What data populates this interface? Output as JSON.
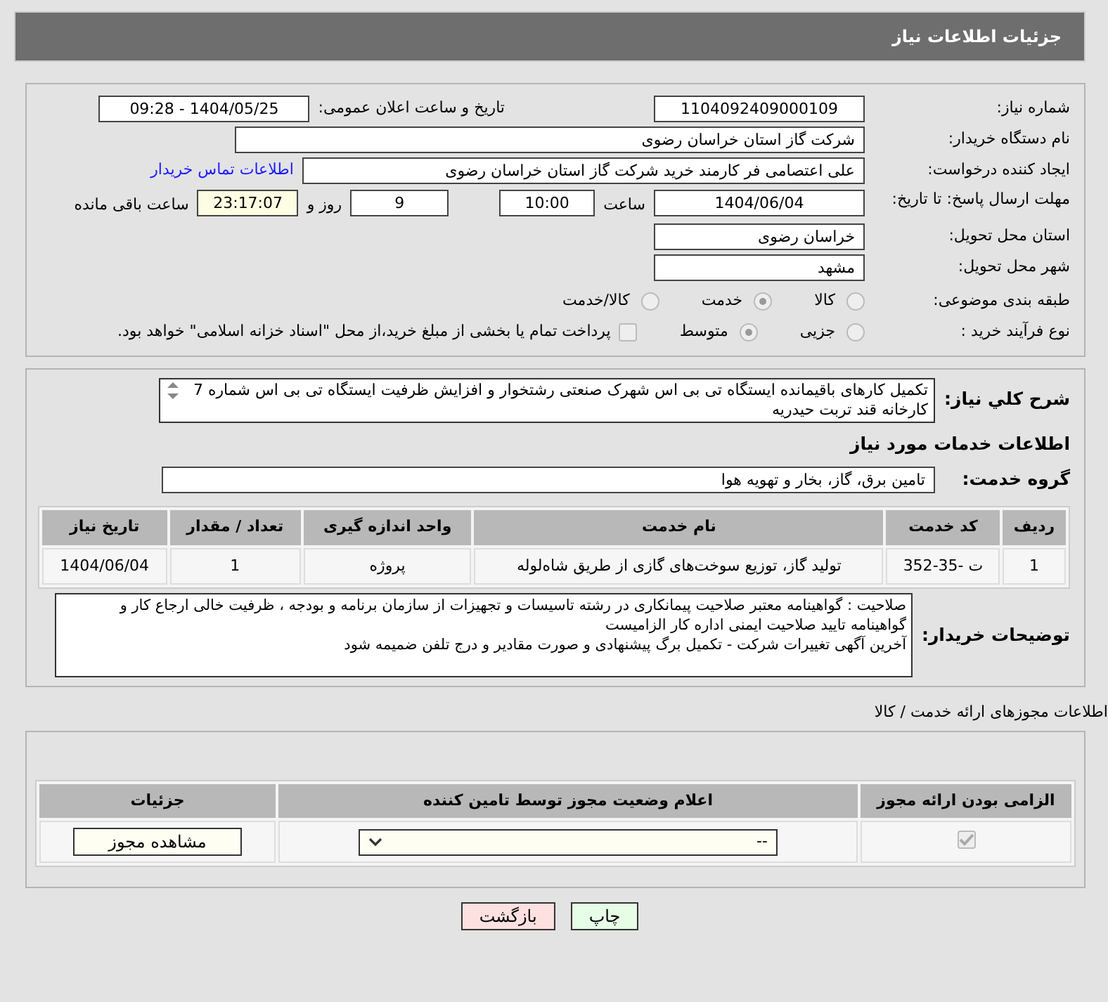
{
  "header": {
    "title": "جزئیات اطلاعات نیاز"
  },
  "need_number": {
    "label": "شماره نیاز:",
    "value": "1104092409000109"
  },
  "announce": {
    "label": "تاریخ و ساعت اعلان عمومی:",
    "value": "1404/05/25 - 09:28"
  },
  "buyer_org": {
    "label": "نام دستگاه خریدار:",
    "value": "شرکت گاز استان خراسان رضوی"
  },
  "requester": {
    "label": "ایجاد کننده درخواست:",
    "value": "علی اعتصامی فر کارمند خرید شرکت گاز استان خراسان رضوی",
    "link": "اطلاعات تماس خریدار"
  },
  "deadline": {
    "label": "مهلت ارسال پاسخ: تا تاریخ:",
    "date": "1404/06/04",
    "time_label": "ساعت",
    "time": "10:00",
    "days": "9",
    "days_label": "روز و",
    "remaining": "23:17:07",
    "remaining_label": "ساعت باقی مانده"
  },
  "province": {
    "label": "استان محل تحویل:",
    "value": "خراسان رضوی"
  },
  "city": {
    "label": "شهر محل تحویل:",
    "value": "مشهد"
  },
  "category": {
    "label": "طبقه بندی موضوعی:",
    "options": [
      {
        "label": "کالا",
        "selected": false
      },
      {
        "label": "خدمت",
        "selected": true
      },
      {
        "label": "کالا/خدمت",
        "selected": false
      }
    ]
  },
  "process": {
    "label": "نوع فرآیند خرید :",
    "options": [
      {
        "label": "جزیی",
        "selected": false
      },
      {
        "label": "متوسط",
        "selected": true
      }
    ],
    "payment": {
      "label": "پرداخت تمام یا بخشی از مبلغ خرید،از محل \"اسناد خزانه اسلامی\" خواهد بود.",
      "checked": false
    }
  },
  "description": {
    "label": "شرح کلي نياز:",
    "value": "تکمیل کارهای باقیمانده ایستگاه تی بی اس شهرک صنعتی رشتخوار  و افزایش ظرفیت ایستگاه تی بی اس شماره 7 کارخانه قند تربت حیدریه"
  },
  "services_heading": "اطلاعات خدمات مورد نیاز",
  "service_group": {
    "label": "گروه خدمت:",
    "value": "تامین برق، گاز، بخار و تهویه هوا"
  },
  "services_table": {
    "columns": [
      "ردیف",
      "کد خدمت",
      "نام خدمت",
      "واحد اندازه گیری",
      "تعداد / مقدار",
      "تاریخ نیاز"
    ],
    "rows": [
      [
        "1",
        "ت -35-352",
        "تولید گاز، توزیع سوخت‌های گازی از طریق شاه‌لوله",
        "پروژه",
        "1",
        "1404/06/04"
      ]
    ]
  },
  "buyer_notes": {
    "label": "توضیحات خریدار:",
    "lines": [
      "صلاحیت : گواهینامه معتبر صلاحیت پیمانکاری در رشته تاسیسات و تجهیزات از سازمان برنامه و بودجه ، ظرفیت خالی ارجاع کار و گواهینامه تایید صلاحیت ایمنی اداره کار  الزامیست",
      "آخرین آگهی تغییرات شرکت - تکمیل برگ پیشنهادی و صورت مقادیر و درج تلفن ضمیمه شود"
    ]
  },
  "permits": {
    "title": "اطلاعات مجوزهای ارائه خدمت / کالا",
    "columns": [
      "الزامی بودن ارائه مجوز",
      "اعلام وضعیت مجوز توسط تامین کننده",
      "جزئیات"
    ],
    "rows": [
      {
        "required": true,
        "status": "--",
        "action": "مشاهده مجوز"
      }
    ]
  },
  "buttons": [
    {
      "label": "چاپ",
      "kind": "print"
    },
    {
      "label": "بازگشت",
      "kind": "back"
    }
  ]
}
